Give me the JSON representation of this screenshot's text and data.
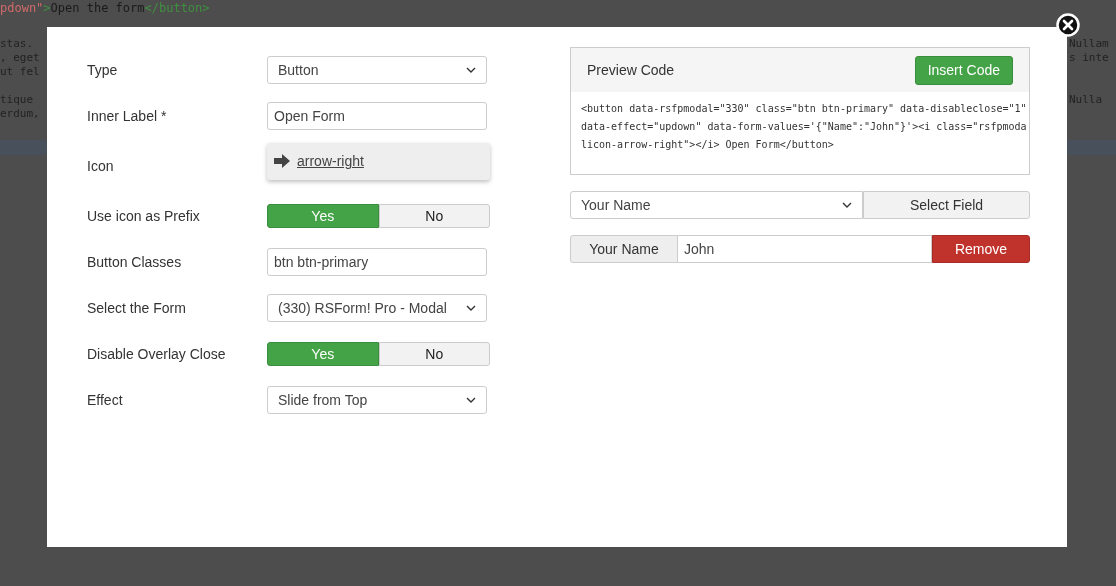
{
  "background": {
    "code_line": [
      {
        "kind": "string",
        "text": "pdown\""
      },
      {
        "kind": "tag",
        "text": ">"
      },
      {
        "kind": "text",
        "text": "Open the form"
      },
      {
        "kind": "tag",
        "text": "</button>"
      }
    ],
    "left_groups": [
      [
        "stas.",
        ", eget",
        "ut fel"
      ],
      [
        "tique",
        "erdum,"
      ]
    ],
    "right_groups": [
      [
        "Nullam",
        "s inte"
      ],
      [
        "Nulla"
      ]
    ]
  },
  "form": {
    "fields": [
      {
        "kind": "select",
        "label": "Type",
        "value": "Button"
      },
      {
        "kind": "input",
        "label": "Inner Label *",
        "value": "Open Form"
      },
      {
        "kind": "icon",
        "label": "Icon",
        "value": "arrow-right"
      },
      {
        "kind": "toggle",
        "label": "Use icon as Prefix",
        "options": [
          {
            "label": "Yes",
            "selected": true
          },
          {
            "label": "No",
            "selected": false
          }
        ]
      },
      {
        "kind": "input",
        "label": "Button Classes",
        "value": "btn btn-primary"
      },
      {
        "kind": "select",
        "label": "Select the Form",
        "value": "(330) RSForm! Pro - Modal"
      },
      {
        "kind": "toggle",
        "label": "Disable Overlay Close",
        "options": [
          {
            "label": "Yes",
            "selected": true
          },
          {
            "label": "No",
            "selected": false
          }
        ]
      },
      {
        "kind": "select",
        "label": "Effect",
        "value": "Slide from Top"
      }
    ]
  },
  "preview": {
    "title": "Preview Code",
    "insert_button": "Insert Code",
    "code": "<button data-rsfpmodal=\"330\" class=\"btn btn-primary\" data-disableclose=\"1\" data-effect=\"updown\" data-form-values='{\"Name\":\"John\"}'><i class=\"rsfpmodalicon-arrow-right\"></i> Open Form</button>"
  },
  "field_picker": {
    "value": "Your Name",
    "button": "Select Field"
  },
  "mappings": [
    {
      "name": "Your Name",
      "value": "John",
      "remove": "Remove"
    }
  ]
}
